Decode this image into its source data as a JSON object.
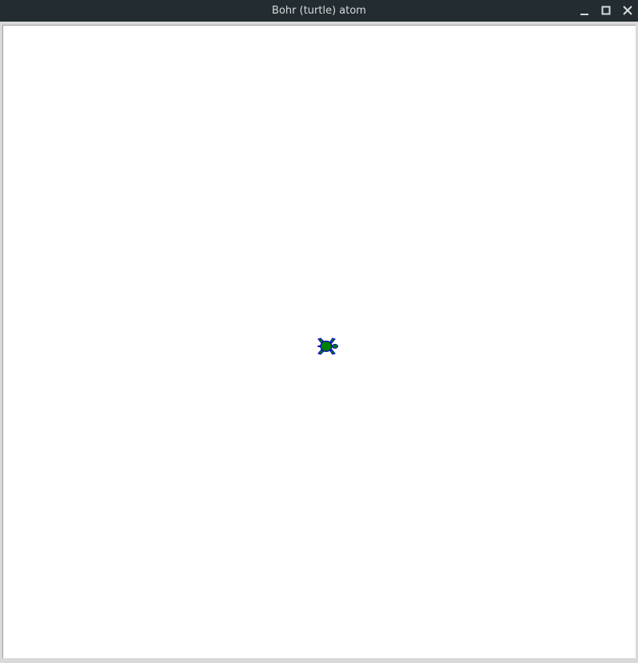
{
  "window": {
    "title": "Bohr (turtle) atom",
    "controls": {
      "minimize_icon": "minimize-icon",
      "maximize_icon": "maximize-icon",
      "close_icon": "close-icon"
    }
  },
  "canvas": {
    "background": "#ffffff",
    "turtle": {
      "fill_color": "#008000",
      "outline_color": "#0000cc",
      "heading": "east"
    }
  },
  "colors": {
    "titlebar": "#232c31",
    "title_text": "#d8dadb"
  }
}
